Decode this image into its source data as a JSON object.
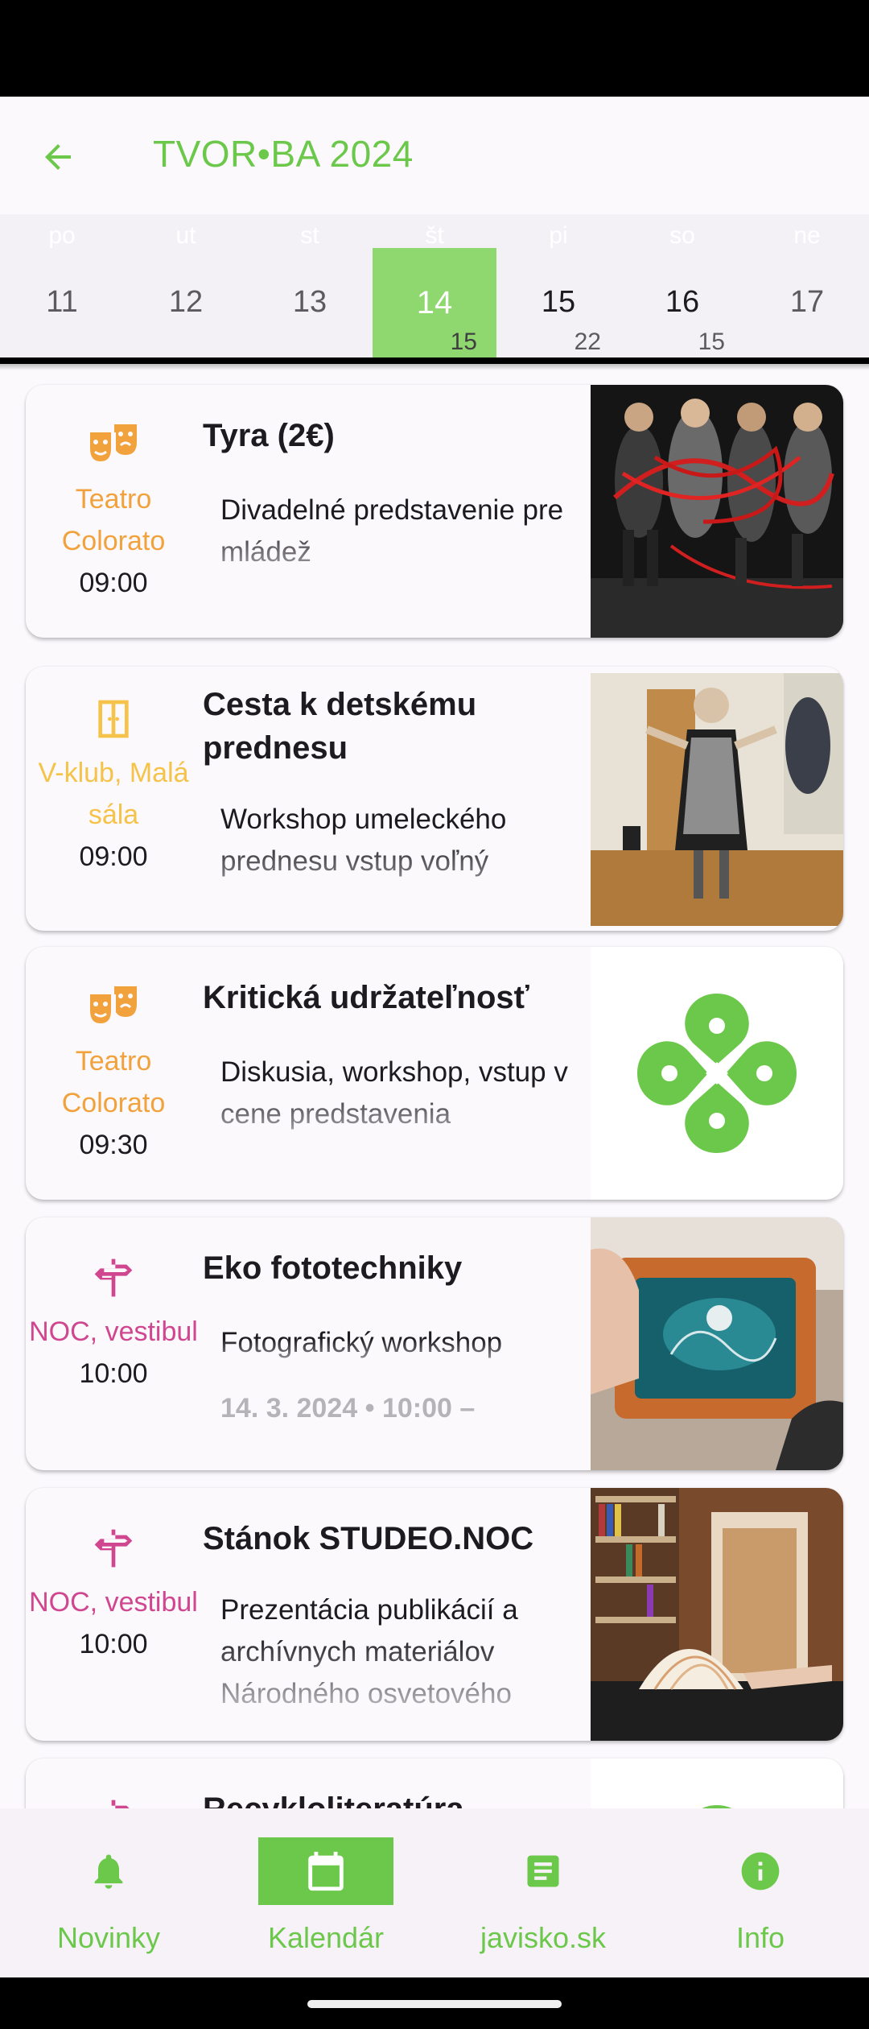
{
  "app": {
    "title": "TVOR•BA 2024"
  },
  "week": [
    {
      "dow": "po",
      "day": "11",
      "count": ""
    },
    {
      "dow": "ut",
      "day": "12",
      "count": ""
    },
    {
      "dow": "st",
      "day": "13",
      "count": ""
    },
    {
      "dow": "št",
      "day": "14",
      "count": "15",
      "active": true
    },
    {
      "dow": "pi",
      "day": "15",
      "count": "22"
    },
    {
      "dow": "so",
      "day": "16",
      "count": "15"
    },
    {
      "dow": "ne",
      "day": "17",
      "count": ""
    }
  ],
  "events": [
    {
      "location": "Teatro Colorato",
      "time": "09:00",
      "title": "Tyra (2€)",
      "description": "Divadelné predstavenie pre mládež",
      "icon": "theatre-masks-icon"
    },
    {
      "location": "V-klub, Malá sála",
      "time": "09:00",
      "title": "Cesta k detskému prednesu",
      "description": "Workshop umeleckého prednesu vstup voľný",
      "icon": "door-icon"
    },
    {
      "location": "Teatro Colorato",
      "time": "09:30",
      "title": "Kritická udržateľnosť",
      "description": "Diskusia, workshop, vstup v cene predstavenia",
      "icon": "theatre-masks-icon"
    },
    {
      "location": "NOC, vestibul",
      "time": "10:00",
      "title": "Eko fototechniky",
      "description": "Fotografický workshop",
      "extra": "14. 3. 2024 • 10:00 –",
      "icon": "signpost-icon"
    },
    {
      "location": "NOC, vestibul",
      "time": "10:00",
      "title": "Stánok STUDEO.NOC",
      "description": "Prezentácia publikácií a archívnych materiálov Národného osvetového",
      "icon": "signpost-icon"
    },
    {
      "location": "",
      "time": "",
      "title": "Recykloliteratúra",
      "description": "",
      "icon": "signpost-icon"
    }
  ],
  "nav": [
    {
      "label": "Novinky",
      "icon": "bell-icon"
    },
    {
      "label": "Kalendár",
      "icon": "calendar-icon",
      "active": true
    },
    {
      "label": "javisko.sk",
      "icon": "article-icon"
    },
    {
      "label": "Info",
      "icon": "info-icon"
    }
  ],
  "colors": {
    "accent": "#6cc84a",
    "active_day": "#8fd86f",
    "theatre": "#f2a23c",
    "vklub": "#f6c34a",
    "noc": "#d0468f"
  }
}
